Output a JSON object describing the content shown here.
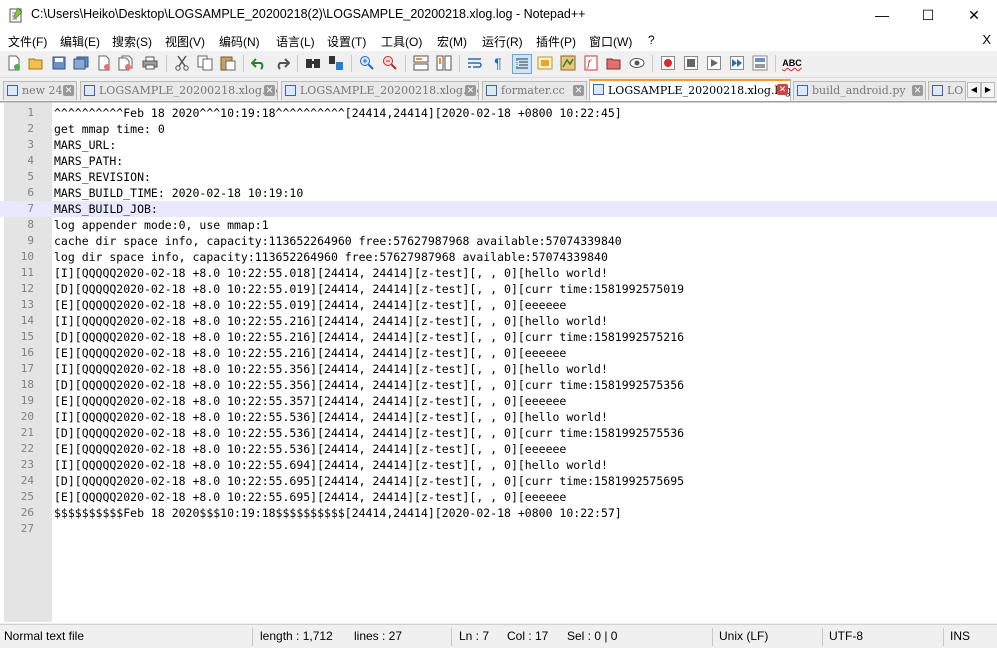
{
  "window": {
    "title": "C:\\Users\\Heiko\\Desktop\\LOGSAMPLE_20200218(2)\\LOGSAMPLE_20200218.xlog.log - Notepad++",
    "minimize": "—",
    "maximize": "☐",
    "close": "✕"
  },
  "menu": {
    "items": [
      "文件(F)",
      "编辑(E)",
      "搜索(S)",
      "视图(V)",
      "编码(N)",
      "语言(L)",
      "设置(T)",
      "工具(O)",
      "宏(M)",
      "运行(R)",
      "插件(P)",
      "窗口(W)",
      "?"
    ],
    "close_doc": "X"
  },
  "toolbar": {
    "icons": [
      "new-file-icon",
      "open-file-icon",
      "save-icon",
      "save-all-icon",
      "close-icon",
      "close-all-icon",
      "print-icon",
      "cut-icon",
      "copy-icon",
      "paste-icon",
      "undo-icon",
      "redo-icon",
      "find-icon",
      "replace-icon",
      "zoom-in-icon",
      "zoom-out-icon",
      "sync-vertical-icon",
      "sync-horizontal-icon",
      "word-wrap-icon",
      "show-all-chars-icon",
      "indent-guide-icon",
      "user-language-icon",
      "doc-map-icon",
      "function-list-icon",
      "folder-workspace-icon",
      "monitor-icon",
      "record-macro-icon",
      "stop-macro-icon",
      "play-macro-icon",
      "run-macro-multiple-icon",
      "save-macro-icon",
      "spellcheck-icon"
    ],
    "spellcheck_label": "ABC"
  },
  "tabs": [
    {
      "label": "new 24",
      "active": false
    },
    {
      "label": "LOGSAMPLE_20200218.xlog.log",
      "active": false
    },
    {
      "label": "LOGSAMPLE_20200218.xlog.log",
      "active": false
    },
    {
      "label": "formater.cc",
      "active": false
    },
    {
      "label": "LOGSAMPLE_20200218.xlog.log",
      "active": true
    },
    {
      "label": "build_android.py",
      "active": false
    },
    {
      "label": "LO",
      "active": false
    }
  ],
  "tab_scroll": {
    "left": "◀",
    "right": "▶"
  },
  "editor": {
    "current_line": 7,
    "lines": [
      "^^^^^^^^^^Feb 18 2020^^^10:19:18^^^^^^^^^^[24414,24414][2020-02-18 +0800 10:22:45]",
      "get mmap time: 0",
      "MARS_URL:",
      "MARS_PATH:",
      "MARS_REVISION:",
      "MARS_BUILD_TIME: 2020-02-18 10:19:10",
      "MARS_BUILD_JOB:",
      "log appender mode:0, use mmap:1",
      "cache dir space info, capacity:113652264960 free:57627987968 available:57074339840",
      "log dir space info, capacity:113652264960 free:57627987968 available:57074339840",
      "[I][QQQQQ2020-02-18 +8.0 10:22:55.018][24414, 24414][z-test][, , 0][hello world!",
      "[D][QQQQQ2020-02-18 +8.0 10:22:55.019][24414, 24414][z-test][, , 0][curr time:1581992575019",
      "[E][QQQQQ2020-02-18 +8.0 10:22:55.019][24414, 24414][z-test][, , 0][eeeeee",
      "[I][QQQQQ2020-02-18 +8.0 10:22:55.216][24414, 24414][z-test][, , 0][hello world!",
      "[D][QQQQQ2020-02-18 +8.0 10:22:55.216][24414, 24414][z-test][, , 0][curr time:1581992575216",
      "[E][QQQQQ2020-02-18 +8.0 10:22:55.216][24414, 24414][z-test][, , 0][eeeeee",
      "[I][QQQQQ2020-02-18 +8.0 10:22:55.356][24414, 24414][z-test][, , 0][hello world!",
      "[D][QQQQQ2020-02-18 +8.0 10:22:55.356][24414, 24414][z-test][, , 0][curr time:1581992575356",
      "[E][QQQQQ2020-02-18 +8.0 10:22:55.357][24414, 24414][z-test][, , 0][eeeeee",
      "[I][QQQQQ2020-02-18 +8.0 10:22:55.536][24414, 24414][z-test][, , 0][hello world!",
      "[D][QQQQQ2020-02-18 +8.0 10:22:55.536][24414, 24414][z-test][, , 0][curr time:1581992575536",
      "[E][QQQQQ2020-02-18 +8.0 10:22:55.536][24414, 24414][z-test][, , 0][eeeeee",
      "[I][QQQQQ2020-02-18 +8.0 10:22:55.694][24414, 24414][z-test][, , 0][hello world!",
      "[D][QQQQQ2020-02-18 +8.0 10:22:55.695][24414, 24414][z-test][, , 0][curr time:1581992575695",
      "[E][QQQQQ2020-02-18 +8.0 10:22:55.695][24414, 24414][z-test][, , 0][eeeeee",
      "$$$$$$$$$$Feb 18 2020$$$10:19:18$$$$$$$$$$[24414,24414][2020-02-18 +0800 10:22:57]",
      ""
    ]
  },
  "status": {
    "file_type": "Normal text file",
    "length": "length : 1,712",
    "lines": "lines : 27",
    "ln": "Ln : 7",
    "col": "Col : 17",
    "sel": "Sel : 0 | 0",
    "eol": "Unix (LF)",
    "encoding": "UTF-8",
    "mode": "INS"
  }
}
